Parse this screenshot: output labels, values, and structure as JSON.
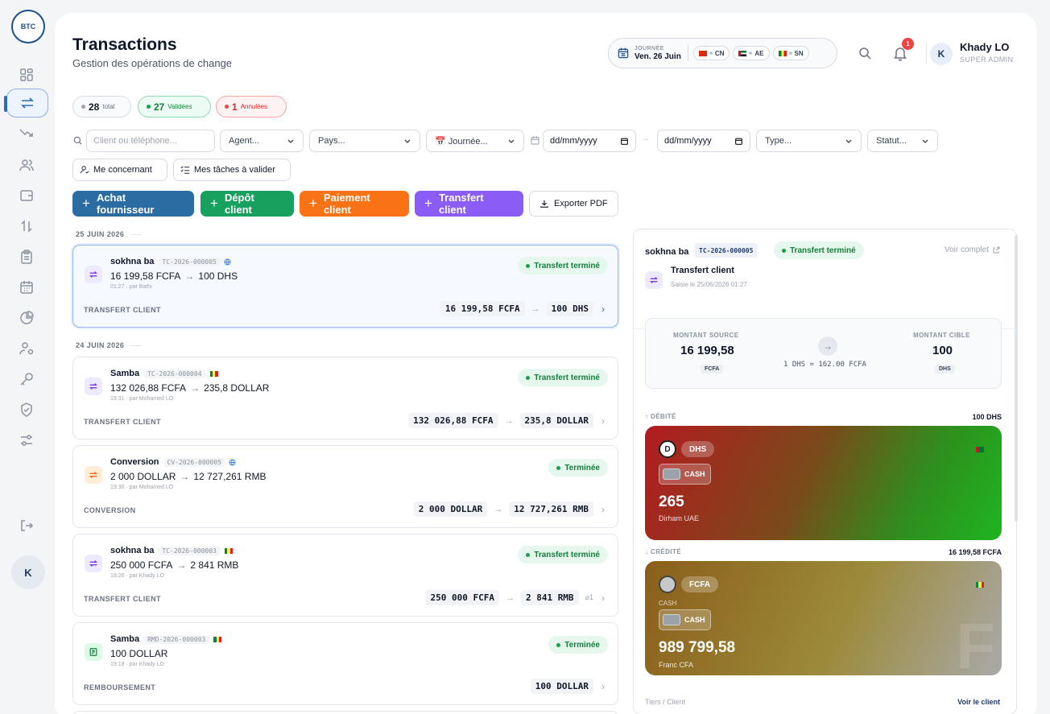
{
  "logo": {
    "text": "BTC"
  },
  "sidebar": {
    "avatar": "K"
  },
  "header": {
    "title": "Transactions",
    "subtitle": "Gestion des opérations de change",
    "day_label": "JOURNÉE",
    "day_value": "Ven. 26 Juin",
    "countries": [
      "CN",
      "AE",
      "SN"
    ],
    "notifications": "1",
    "user_initial": "K",
    "user_name": "Khady LO",
    "user_role": "SUPER ADMIN"
  },
  "counts": {
    "total": {
      "value": "28",
      "label": "total"
    },
    "validated": {
      "value": "27",
      "label": "Validées"
    },
    "cancelled": {
      "value": "1",
      "label": "Annulées"
    }
  },
  "filters": {
    "search_placeholder": "Client ou téléphone...",
    "agent": "Agent...",
    "pays": "Pays...",
    "journee": "📅 Journée...",
    "date_from": "dd/mm/yyyy",
    "date_to": "dd/mm/yyyy",
    "type": "Type...",
    "statut": "Statut...",
    "mine": "Me concernant",
    "tasks": "Mes tâches à valider"
  },
  "actions": {
    "achat": "Achat fournisseur",
    "depot": "Dépôt client",
    "paiement": "Paiement client",
    "transfert": "Transfert client",
    "export": "Exporter PDF"
  },
  "groups": [
    {
      "date": "25 JUIN 2026"
    },
    {
      "date": "24 JUIN 2026"
    }
  ],
  "transactions": [
    {
      "name": "sokhna ba",
      "ref": "TC-2026-000005",
      "amount_from": "16 199,58 FCFA",
      "amount_to": "100 DHS",
      "meta": "01:27 · par Bathi",
      "status": "Transfert terminé",
      "type": "TRANSFERT CLIENT",
      "pill_from": "16 199,58 FCFA",
      "pill_to": "100 DHS"
    },
    {
      "name": "Samba",
      "ref": "TC-2026-000004",
      "amount_from": "132 026,88 FCFA",
      "amount_to": "235,8 DOLLAR",
      "meta": "19:31 · par Mohamed LO",
      "status": "Transfert terminé",
      "type": "TRANSFERT CLIENT",
      "pill_from": "132 026,88 FCFA",
      "pill_to": "235,8 DOLLAR"
    },
    {
      "name": "Conversion",
      "ref": "CV-2026-000005",
      "amount_from": "2 000 DOLLAR",
      "amount_to": "12 727,261 RMB",
      "meta": "19:30 · par Mohamed LO",
      "status": "Terminée",
      "type": "CONVERSION",
      "pill_from": "2 000 DOLLAR",
      "pill_to": "12 727,261 RMB"
    },
    {
      "name": "sokhna ba",
      "ref": "TC-2026-000003",
      "amount_from": "250 000 FCFA",
      "amount_to": "2 841 RMB",
      "meta": "19:26 · par Khady LO",
      "status": "Transfert terminé",
      "type": "TRANSFERT CLIENT",
      "pill_from": "250 000 FCFA",
      "pill_to": "2 841 RMB",
      "attachments": "1"
    },
    {
      "name": "Samba",
      "ref": "RMD-2026-000003",
      "amount_from": "100 DOLLAR",
      "meta": "19:18 · par Khady LO",
      "status": "Terminée",
      "type": "REMBOURSEMENT",
      "pill_from": "100 DOLLAR"
    }
  ],
  "detail": {
    "name": "sokhna ba",
    "ref": "TC-2026-000005",
    "status": "Transfert terminé",
    "see_full": "Voir complet",
    "type": "Transfert client",
    "saisie": "Saisie le 25/06/2026 01:27",
    "source_label": "MONTANT SOURCE",
    "source_value": "16 199,58",
    "source_cur": "FCFA",
    "target_label": "MONTANT CIBLE",
    "target_value": "100",
    "target_cur": "DHS",
    "rate": "1 DHS = 162.00 FCFA",
    "debit_label": "↑ DÉBITÉ",
    "debit_value": "100 DHS",
    "credit_label": "↓ CRÉDITÉ",
    "credit_value": "16 199,58 FCFA",
    "card1": {
      "coin": "D",
      "currency": "DHS",
      "cash": "CASH",
      "amount": "265",
      "name": "Dirham UAE"
    },
    "card2": {
      "currency": "FCFA",
      "cash_small": "CASH",
      "cash": "CASH",
      "amount": "989 799,58",
      "name": "Franc CFA",
      "watermark": "F"
    },
    "footer_left": "Tiers / Client",
    "footer_right": "Voir le client"
  }
}
